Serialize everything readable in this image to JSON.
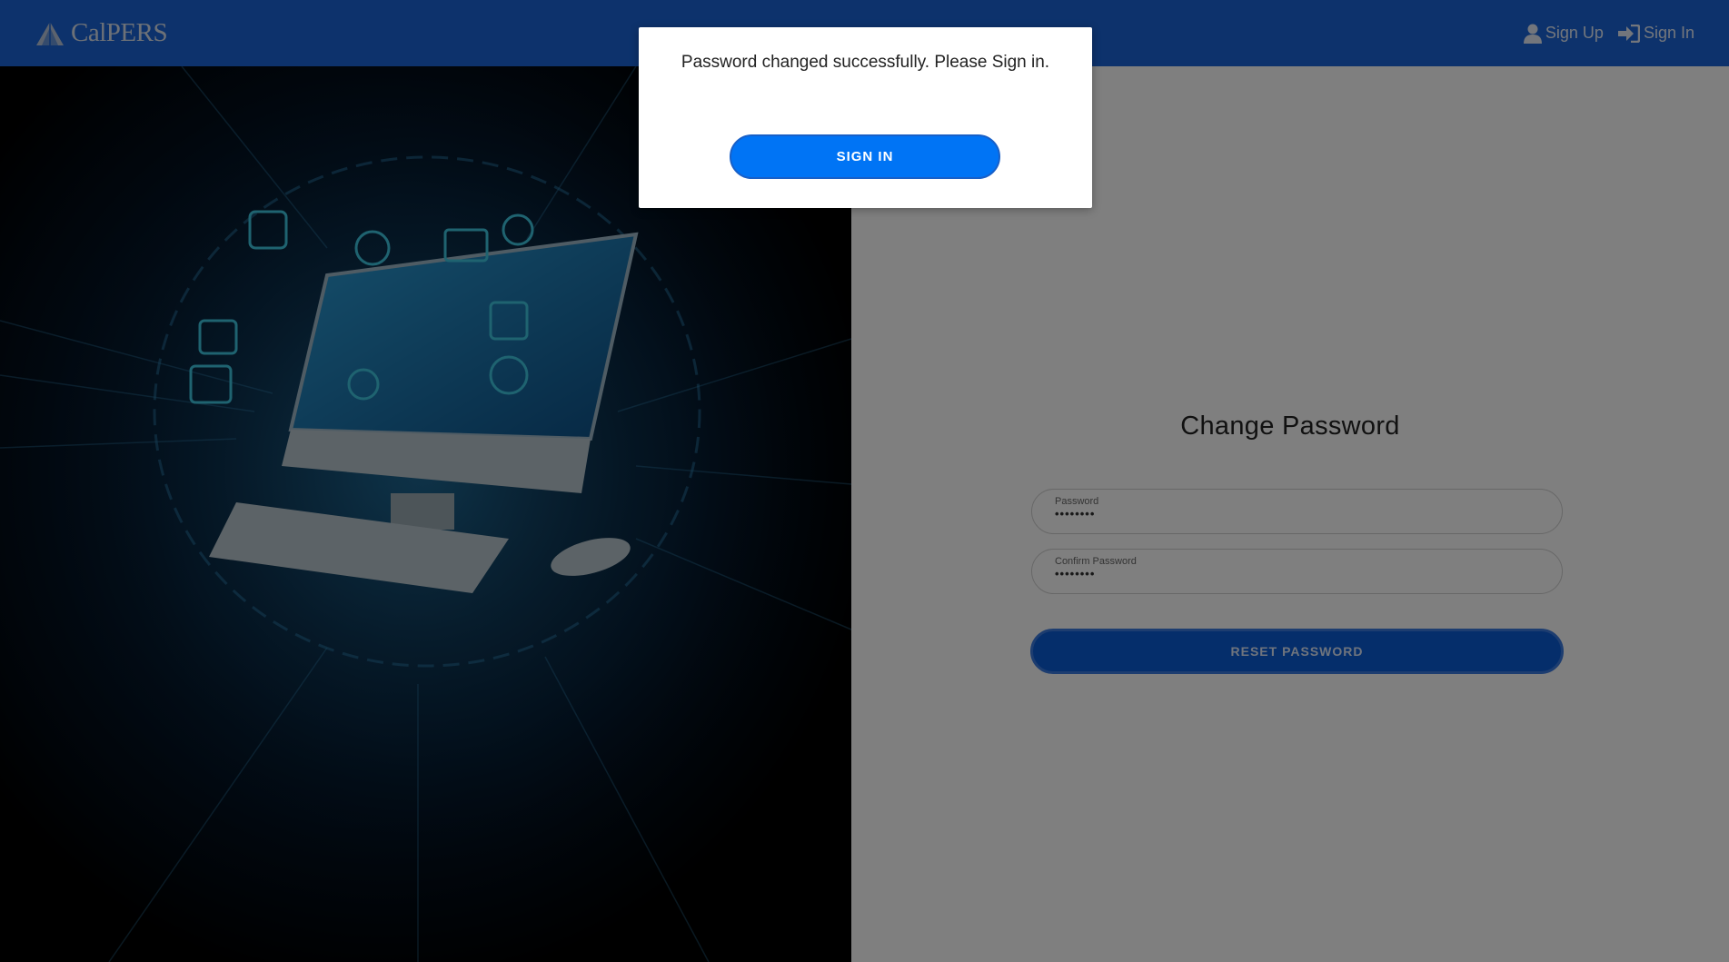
{
  "header": {
    "logo_text": "CalPERS",
    "nav": {
      "sign_up_label": "Sign Up",
      "sign_in_label": "Sign In"
    }
  },
  "form": {
    "title": "Change Password",
    "password_label": "Password",
    "password_value": "••••••••",
    "confirm_label": "Confirm Password",
    "confirm_value": "••••••••",
    "reset_button_label": "RESET PASSWORD"
  },
  "modal": {
    "message": "Password changed successfully. Please Sign in.",
    "sign_in_button_label": "SIGN IN"
  },
  "colors": {
    "header_bg": "#1a65d9",
    "primary_button": "#0074f5",
    "reset_button": "#0a5cd6"
  },
  "icons": [
    "user-icon",
    "sign-in-icon",
    "calpers-logo-icon"
  ]
}
